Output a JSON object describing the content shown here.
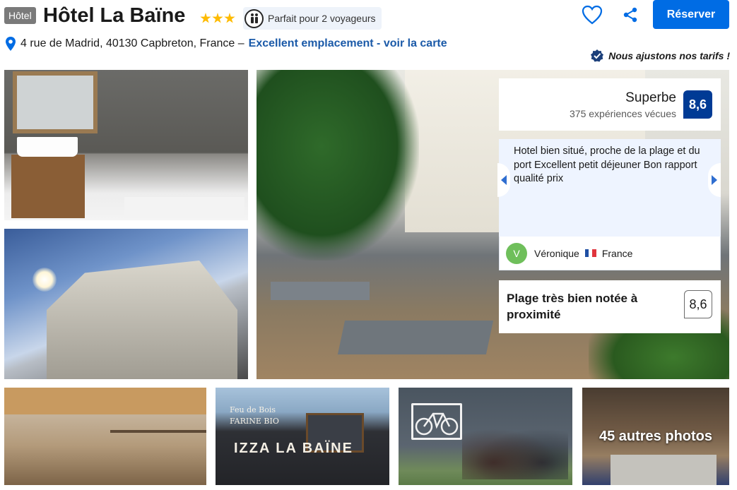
{
  "header": {
    "type_badge": "Hôtel",
    "hotel_name": "Hôtel La Baïne",
    "stars": 3,
    "occupancy": "Parfait pour 2 voyageurs",
    "reserve_label": "Réserver",
    "address": "4 rue de Madrid, 40130 Capbreton, France –",
    "map_link": "Excellent emplacement - voir la carte",
    "price_note": "Nous ajustons nos tarifs !"
  },
  "review": {
    "rating_word": "Superbe",
    "reviews_count": "375 expériences vécues",
    "score": "8,6",
    "quote": "Hotel bien situé, proche de la plage et du port Excellent petit déjeuner Bon rapport qualité prix",
    "reviewer_initial": "V",
    "reviewer_name": "Véronique",
    "reviewer_country": "France"
  },
  "beach": {
    "label": "Plage très bien notée à proximité",
    "score": "8,6"
  },
  "photos": {
    "truck_line1": "Feu de Bois",
    "truck_line2": "FARINE BIO",
    "truck_logo": "IZZA  LA BAÏNE",
    "more_photos": "45 autres photos"
  },
  "icons": {
    "heart": "heart-icon",
    "share": "share-icon",
    "pin": "map-pin-icon",
    "verified": "verified-check-icon",
    "people": "people-icon"
  },
  "colors": {
    "brand_blue": "#006ce4",
    "score_blue": "#003b95",
    "link_blue": "#1b5aa8",
    "star_yellow": "#febb02",
    "avatar_green": "#6fbf5b",
    "badge_grey": "#7a7a7a"
  }
}
